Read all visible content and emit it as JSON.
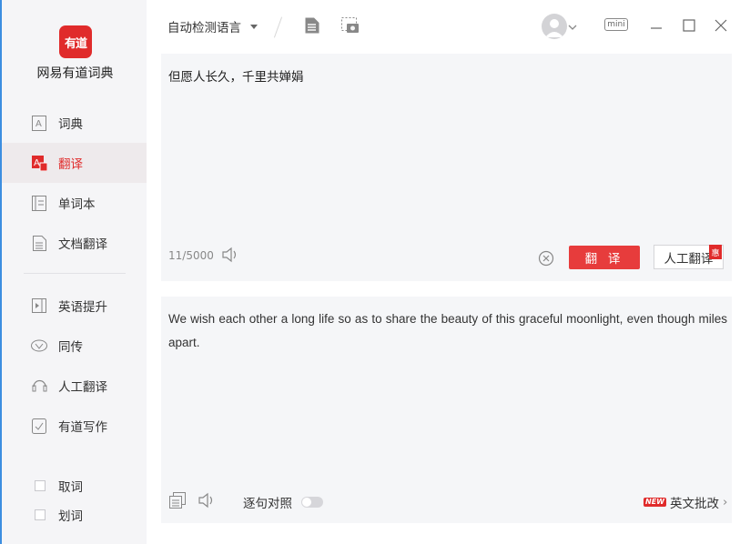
{
  "app": {
    "logo_text": "有道",
    "name": "网易有道词典",
    "brand_color": "#e02b2b"
  },
  "sidebar": {
    "items": [
      {
        "label": "词典",
        "icon": "dictionary-icon",
        "active": false
      },
      {
        "label": "翻译",
        "icon": "translate-icon",
        "active": true
      },
      {
        "label": "单词本",
        "icon": "wordbook-icon",
        "active": false
      },
      {
        "label": "文档翻译",
        "icon": "document-icon",
        "active": false
      },
      {
        "label": "英语提升",
        "icon": "video-play-icon",
        "active": false
      },
      {
        "label": "同传",
        "icon": "simultaneous-icon",
        "active": false
      },
      {
        "label": "人工翻译",
        "icon": "headset-icon",
        "active": false
      },
      {
        "label": "有道写作",
        "icon": "writing-icon",
        "active": false
      }
    ],
    "toggles": [
      {
        "label": "取词",
        "checked": false
      },
      {
        "label": "划词",
        "checked": false
      }
    ]
  },
  "topbar": {
    "language": "自动检测语言",
    "mini_label": "mini"
  },
  "input": {
    "text": "但愿人长久，千里共婵娟",
    "count": "11/5000",
    "translate_label": "翻 译",
    "human_label": "人工翻译",
    "human_badge": "惠"
  },
  "output": {
    "text": "We wish each other a long life so as to share the beauty of this graceful moonlight, even though miles apart.",
    "compare_label": "逐句对照",
    "compare_enabled": false,
    "new_badge": "NEW",
    "correction_label": "英文批改",
    "correction_arrow": "›"
  }
}
